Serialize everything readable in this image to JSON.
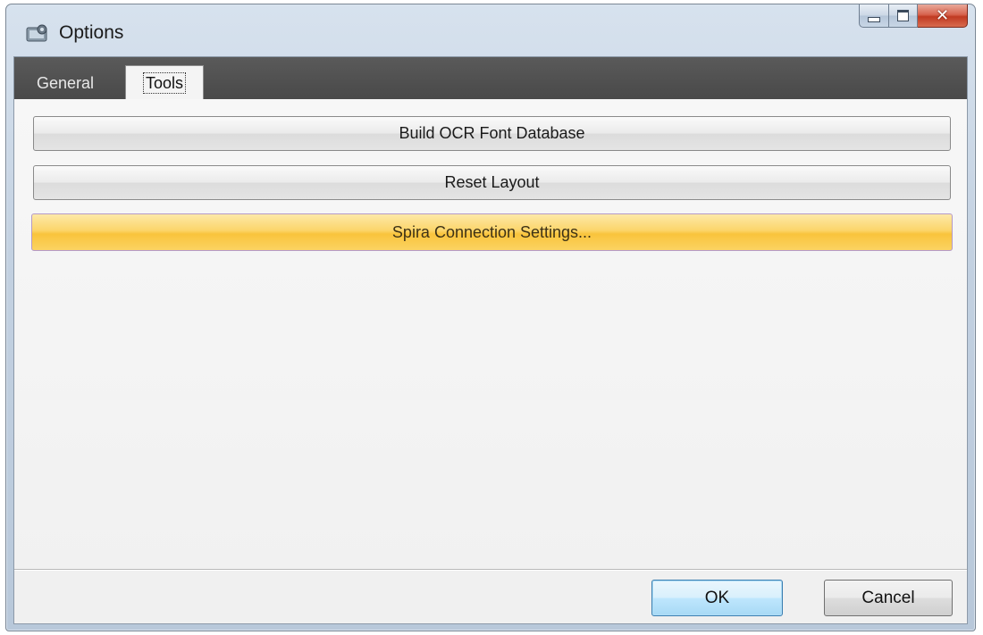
{
  "window": {
    "title": "Options",
    "icon": "app-settings-icon",
    "caption_buttons": [
      "minimize-icon",
      "maximize-icon",
      "close-icon"
    ]
  },
  "tabs": [
    {
      "label": "General",
      "active": false
    },
    {
      "label": "Tools",
      "active": true
    }
  ],
  "tools_panel": {
    "buttons": [
      {
        "label": "Build OCR Font Database",
        "state": "normal"
      },
      {
        "label": "Reset Layout",
        "state": "normal"
      },
      {
        "label": "Spira Connection Settings...",
        "state": "hover"
      }
    ]
  },
  "footer": {
    "ok_label": "OK",
    "cancel_label": "Cancel"
  },
  "colors": {
    "hover_accent": "#f9c43c",
    "default_button_border": "#3c7fb1",
    "tabstrip_bg": "#4f4f4f"
  }
}
